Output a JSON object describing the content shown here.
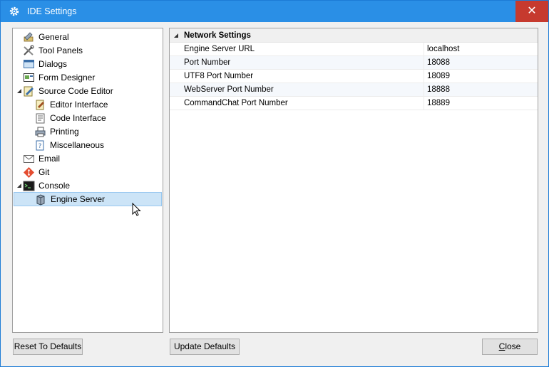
{
  "window": {
    "title": "IDE Settings",
    "close_glyph": "✕"
  },
  "tree": {
    "items": [
      {
        "label": "General",
        "icon": "general-icon"
      },
      {
        "label": "Tool Panels",
        "icon": "tool-panels-icon"
      },
      {
        "label": "Dialogs",
        "icon": "dialogs-icon"
      },
      {
        "label": "Form Designer",
        "icon": "form-designer-icon"
      },
      {
        "label": "Source Code Editor",
        "icon": "source-code-editor-icon",
        "expanded": true
      },
      {
        "label": "Editor Interface",
        "icon": "editor-interface-icon"
      },
      {
        "label": "Code Interface",
        "icon": "code-interface-icon"
      },
      {
        "label": "Printing",
        "icon": "printing-icon"
      },
      {
        "label": "Miscellaneous",
        "icon": "miscellaneous-icon"
      },
      {
        "label": "Email",
        "icon": "email-icon"
      },
      {
        "label": "Git",
        "icon": "git-icon"
      },
      {
        "label": "Console",
        "icon": "console-icon",
        "expanded": true
      },
      {
        "label": "Engine Server",
        "icon": "engine-server-icon",
        "selected": true
      }
    ]
  },
  "grid": {
    "category": "Network Settings",
    "rows": [
      {
        "name": "Engine Server URL",
        "value": "localhost"
      },
      {
        "name": "Port Number",
        "value": "18088"
      },
      {
        "name": "UTF8 Port Number",
        "value": "18089"
      },
      {
        "name": "WebServer Port Number",
        "value": "18888"
      },
      {
        "name": "CommandChat Port Number",
        "value": "18889"
      }
    ]
  },
  "buttons": {
    "reset": "Reset To Defaults",
    "update": "Update Defaults",
    "close_first": "C",
    "close_rest": "lose"
  },
  "colors": {
    "titlebar": "#2a8fe6",
    "close": "#c63a2e",
    "selection": "#cce4f7"
  }
}
